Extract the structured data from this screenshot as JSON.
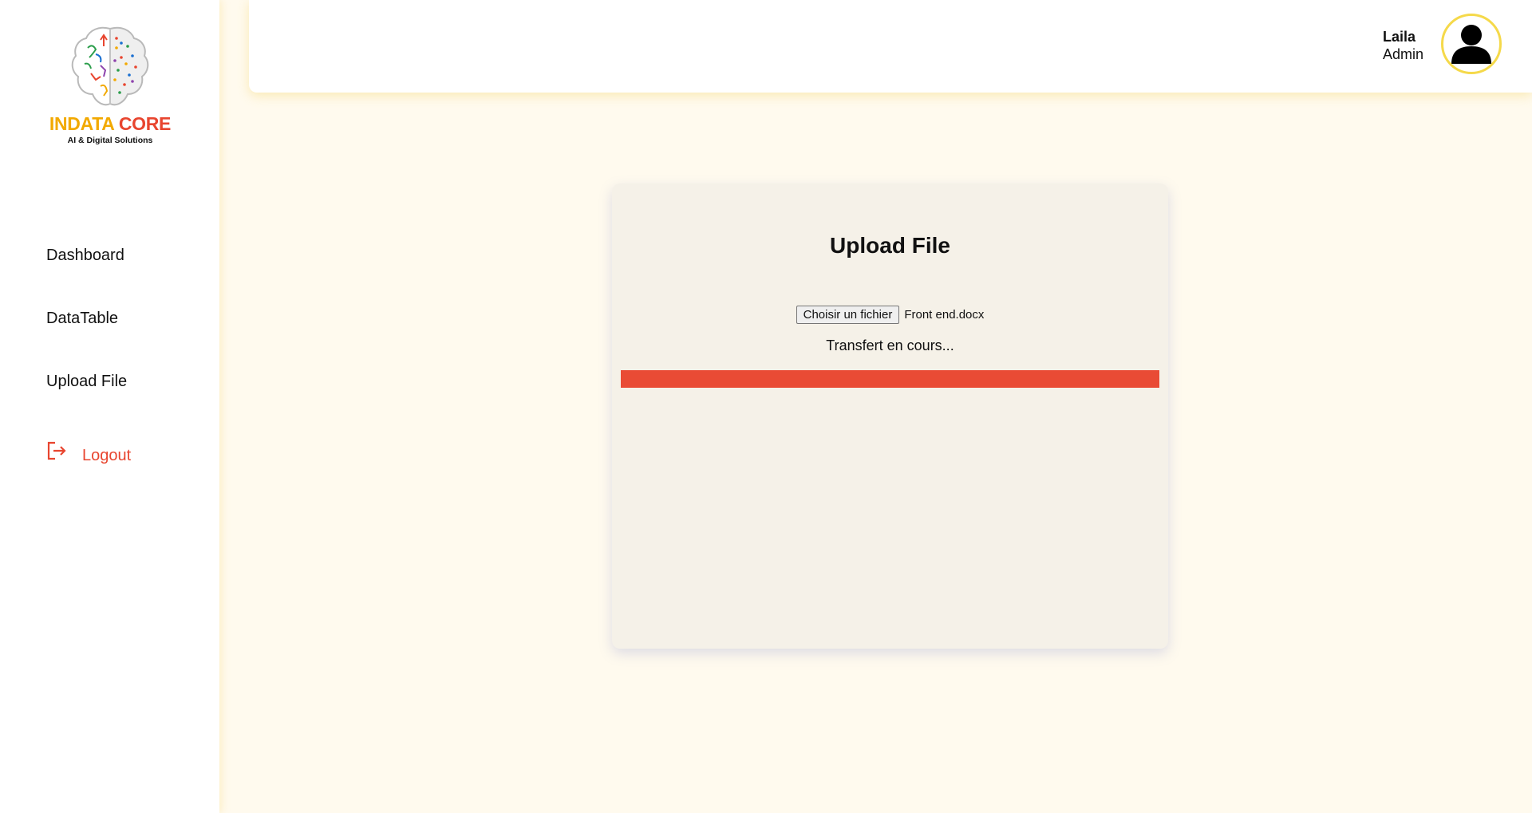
{
  "brand": {
    "name_part1": "INDATA",
    "name_part2": "CORE",
    "tagline": "AI & Digital Solutions"
  },
  "sidebar": {
    "items": [
      {
        "label": "Dashboard",
        "icon": ""
      },
      {
        "label": "DataTable",
        "icon": ""
      },
      {
        "label": "Upload File",
        "icon": ""
      }
    ],
    "logout": {
      "label": "Logout",
      "icon": "logout-icon",
      "color": "#e8452f"
    }
  },
  "header": {
    "user_name": "Laila",
    "user_role": "Admin",
    "avatar_icon": "user-avatar-icon",
    "avatar_border_color": "#f5d94a"
  },
  "upload": {
    "title": "Upload File",
    "choose_button": "Choisir un fichier",
    "file_name": "Front end.docx",
    "status": "Transfert en cours...",
    "progress_percent": 100,
    "progress_color": "#e94b35"
  },
  "colors": {
    "background": "#fffaee",
    "card": "#f5f1e8",
    "accent_yellow": "#f2a900",
    "accent_red": "#e8452f"
  }
}
